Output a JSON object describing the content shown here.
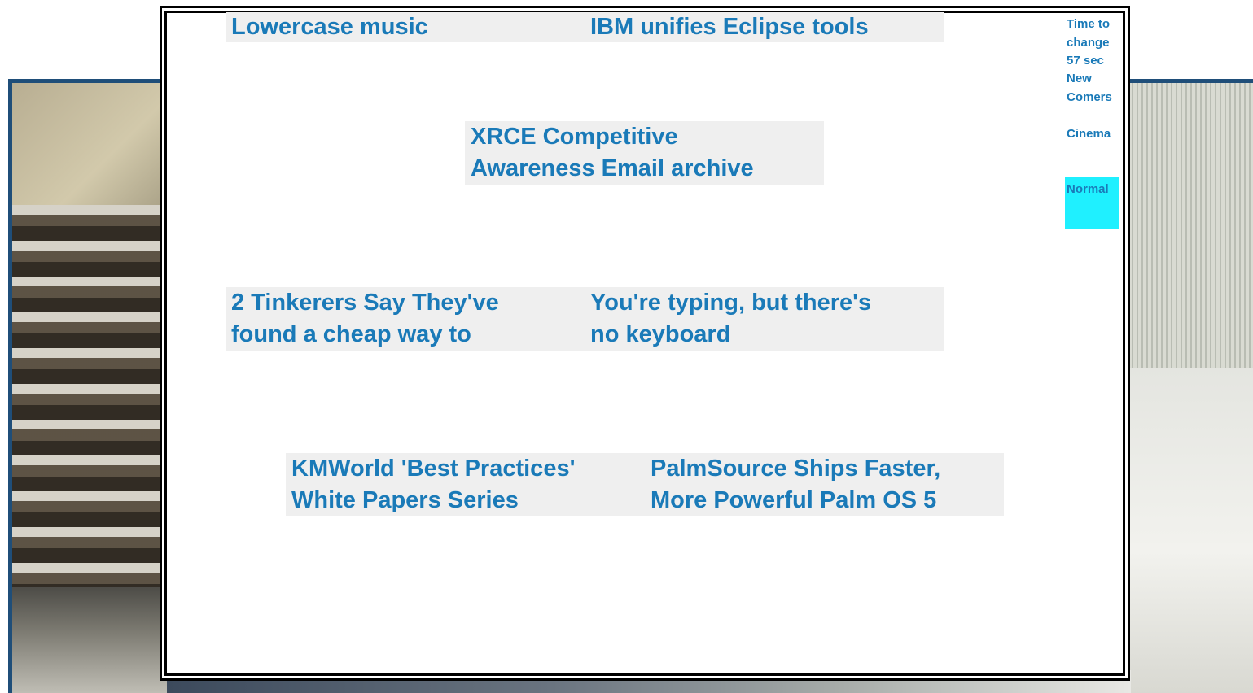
{
  "headlines": [
    {
      "line1": "Lowercase music",
      "line2": ""
    },
    {
      "line1": "IBM unifies Eclipse tools",
      "line2": ""
    },
    {
      "line1": "XRCE Competitive",
      "line2": "Awareness Email archive"
    },
    {
      "line1": "2 Tinkerers Say They've",
      "line2": "found a cheap way to"
    },
    {
      "line1": "You're typing, but there's",
      "line2": "no keyboard"
    },
    {
      "line1": "KMWorld 'Best Practices'",
      "line2": "White Papers Series"
    },
    {
      "line1": "PalmSource Ships Faster,",
      "line2": "More Powerful Palm OS 5"
    }
  ],
  "sidebar": {
    "timer_line1": "Time to",
    "timer_line2": "change",
    "timer_value": "57 sec",
    "newcomers_line1": "New",
    "newcomers_line2": "Comers",
    "cinema_label": "Cinema",
    "normal_label": "Normal"
  },
  "colors": {
    "headline_text": "#1a7ab8",
    "headline_bg": "#efefef",
    "normal_bg": "#1ff0ff",
    "frame": "#000000"
  }
}
